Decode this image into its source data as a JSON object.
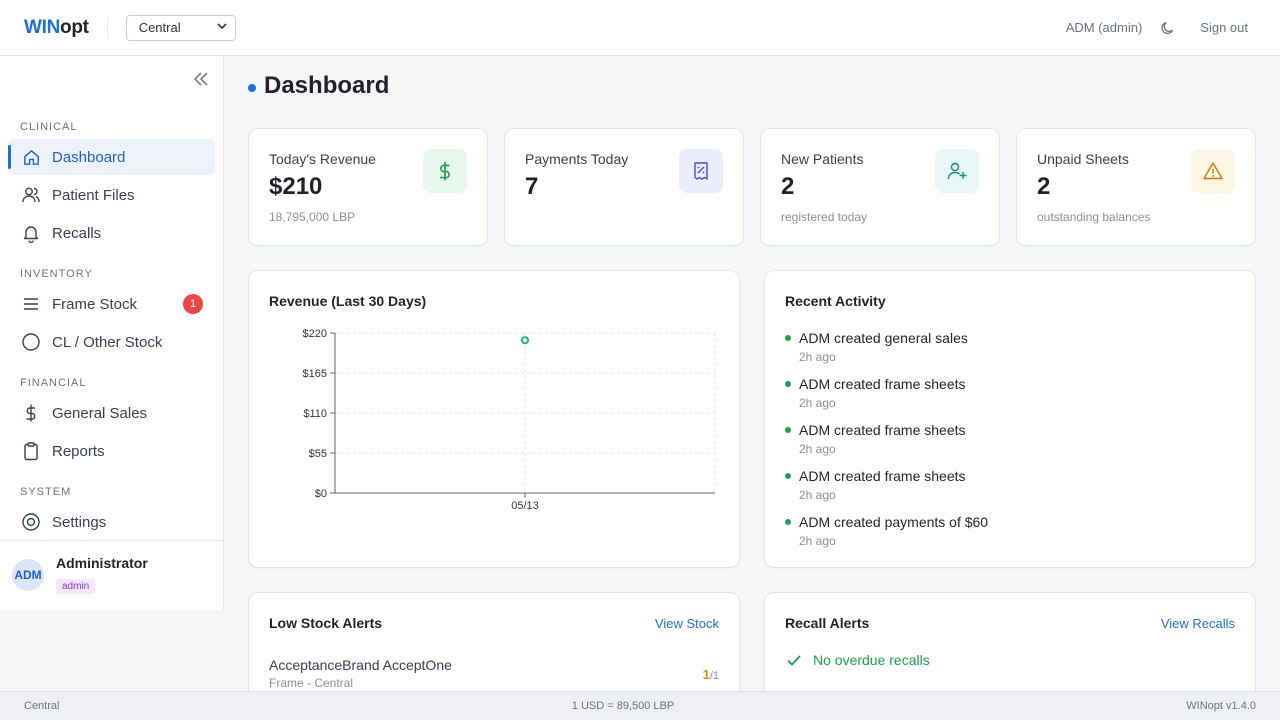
{
  "header": {
    "logo_part1": "WIN",
    "logo_part2": "opt",
    "branch_selected": "Central",
    "user_label": "ADM (admin)",
    "sign_out": "Sign out"
  },
  "sidebar": {
    "sections": {
      "clinical": "CLINICAL",
      "inventory": "INVENTORY",
      "financial": "FINANCIAL",
      "system": "SYSTEM"
    },
    "items": [
      {
        "label": "Dashboard",
        "icon": "home-icon",
        "active": true
      },
      {
        "label": "Patient Files",
        "icon": "users-icon"
      },
      {
        "label": "Recalls",
        "icon": "bell-icon"
      },
      {
        "label": "Frame Stock",
        "icon": "list-icon",
        "badge": "1"
      },
      {
        "label": "CL / Other Stock",
        "icon": "circle-icon"
      },
      {
        "label": "General Sales",
        "icon": "dollar-icon"
      },
      {
        "label": "Reports",
        "icon": "clipboard-icon"
      },
      {
        "label": "Settings",
        "icon": "settings-icon"
      }
    ],
    "profile": {
      "initials": "ADM",
      "name": "Administrator",
      "role": "admin"
    }
  },
  "page": {
    "title": "Dashboard"
  },
  "stats": [
    {
      "label": "Today's Revenue",
      "value": "$210",
      "sub": "18,795,000 LBP",
      "icon": "dollar-icon",
      "color": "#16a34a"
    },
    {
      "label": "Payments Today",
      "value": "7",
      "sub": "",
      "icon": "receipt-icon",
      "color": "#4f46e5"
    },
    {
      "label": "New Patients",
      "value": "2",
      "sub": "registered today",
      "icon": "user-plus-icon",
      "color": "#0d9488"
    },
    {
      "label": "Unpaid Sheets",
      "value": "2",
      "sub": "outstanding balances",
      "icon": "warning-icon",
      "color": "#d97706"
    }
  ],
  "revenue_card": {
    "title": "Revenue (Last 30 Days)"
  },
  "chart_data": {
    "type": "line",
    "title": "Revenue (Last 30 Days)",
    "categories": [
      "05/13"
    ],
    "series": [
      {
        "values": [
          210
        ]
      }
    ],
    "ylim": [
      0,
      220
    ],
    "yticks": [
      "$0",
      "$55",
      "$110",
      "$165",
      "$220"
    ],
    "ytick_values": [
      0,
      55,
      110,
      165,
      220
    ],
    "grid": true,
    "xlabel": "",
    "ylabel": ""
  },
  "activity": {
    "title": "Recent Activity",
    "items": [
      {
        "text": "ADM created general sales",
        "time": "2h ago"
      },
      {
        "text": "ADM created frame sheets",
        "time": "2h ago"
      },
      {
        "text": "ADM created frame sheets",
        "time": "2h ago"
      },
      {
        "text": "ADM created frame sheets",
        "time": "2h ago"
      },
      {
        "text": "ADM created payments of $60",
        "time": "2h ago"
      }
    ]
  },
  "low_stock": {
    "title": "Low Stock Alerts",
    "link": "View Stock",
    "items": [
      {
        "name": "AcceptanceBrand AcceptOne",
        "sub": "Frame - Central",
        "qty": "1",
        "total": "/1"
      }
    ]
  },
  "recall": {
    "title": "Recall Alerts",
    "link": "View Recalls",
    "ok": "No overdue recalls"
  },
  "footer": {
    "branch": "Central",
    "rate": "1 USD = 89,500 LBP",
    "version": "WINopt v1.4.0"
  }
}
